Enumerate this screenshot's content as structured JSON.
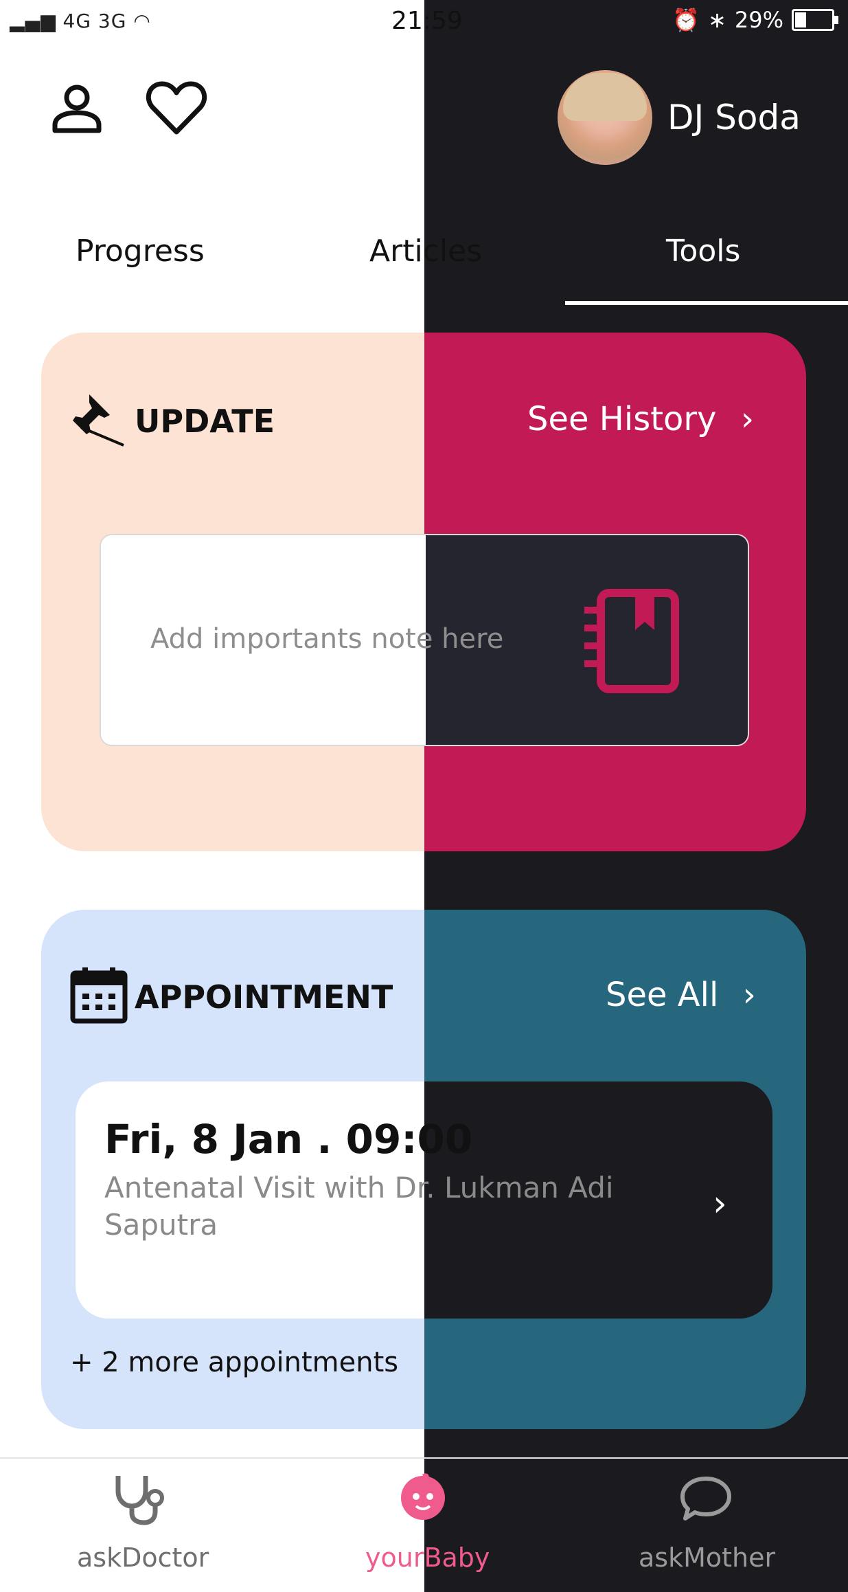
{
  "status_bar": {
    "network": "4G 3G",
    "time": "21:59",
    "battery_percent": "29%",
    "battery_level": 0.29
  },
  "header": {
    "profile_icon": "user-icon",
    "favorite_icon": "heart-icon",
    "user_name": "DJ Soda"
  },
  "tabs": [
    {
      "label": "Progress",
      "active": false
    },
    {
      "label": "Articles",
      "active": false
    },
    {
      "label": "Tools",
      "active": true
    }
  ],
  "update_card": {
    "icon": "pin-icon",
    "title": "UPDATE",
    "link_label": "See History",
    "note_placeholder": "Add importants note here",
    "note_icon": "notebook-icon"
  },
  "appointment_card": {
    "icon": "calendar-icon",
    "title": "APPOINTMENT",
    "link_label": "See All",
    "appointment": {
      "datetime": "Fri, 8 Jan . 09:00",
      "description": "Antenatal Visit with Dr. Lukman Adi Saputra"
    },
    "more_label": "+ 2 more appointments"
  },
  "bottom_nav": [
    {
      "label": "askDoctor",
      "icon": "stethoscope-icon"
    },
    {
      "label": "yourBaby",
      "icon": "baby-icon",
      "active": true
    },
    {
      "label": "askMother",
      "icon": "chat-bubble-icon"
    }
  ],
  "colors": {
    "dark_bg": "#1b1a1f",
    "update_light": "#fde3d4",
    "update_dark": "#c11a54",
    "appt_light": "#d5e4fb",
    "appt_dark": "#26677e",
    "accent_pink": "#ee5b8c"
  }
}
